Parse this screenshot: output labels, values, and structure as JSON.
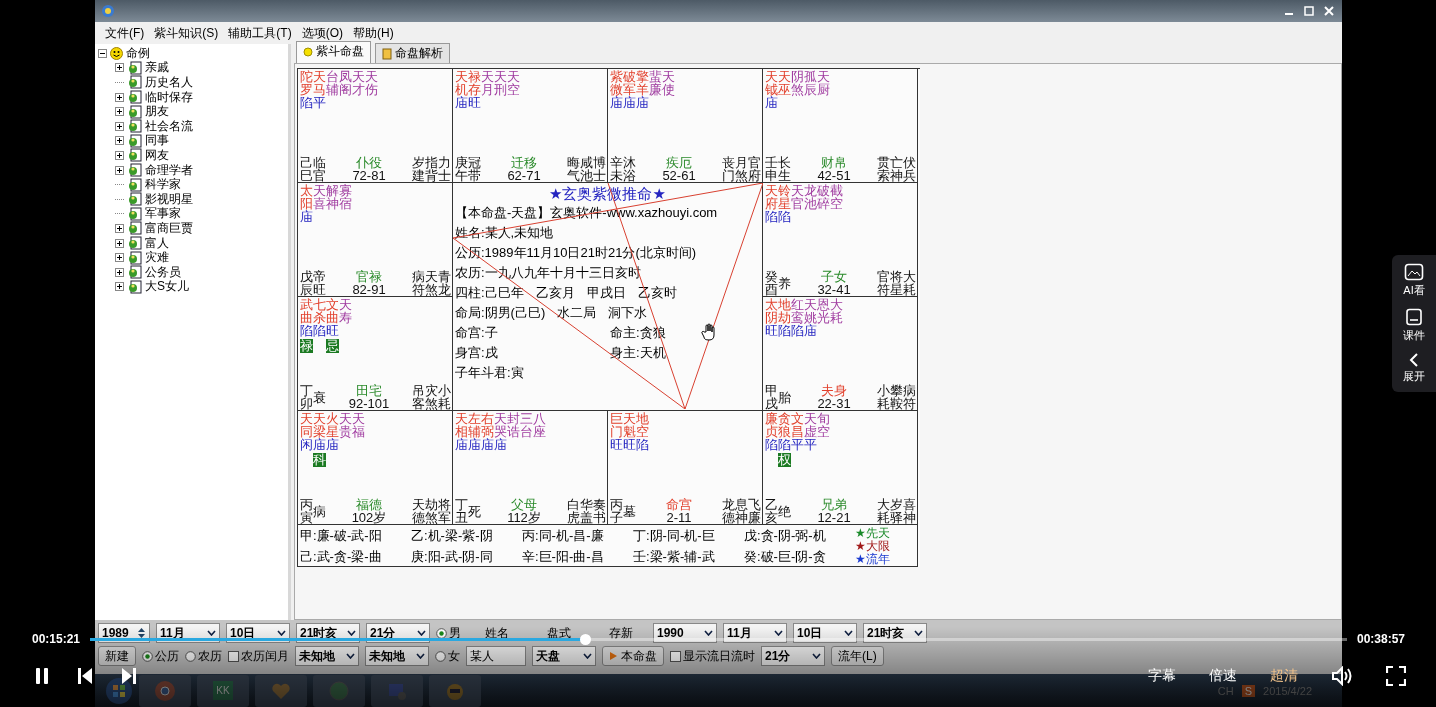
{
  "menu": [
    "文件(F)",
    "紫斗知识(S)",
    "辅助工具(T)",
    "选项(O)",
    "帮助(H)"
  ],
  "tree": {
    "root": {
      "label": "命例",
      "expanded": true,
      "children": [
        {
          "label": "亲戚",
          "has_children": true
        },
        {
          "label": "历史名人",
          "has_children": false
        },
        {
          "label": "临时保存",
          "has_children": true
        },
        {
          "label": "朋友",
          "has_children": true
        },
        {
          "label": "社会名流",
          "has_children": true
        },
        {
          "label": "同事",
          "has_children": true
        },
        {
          "label": "网友",
          "has_children": true
        },
        {
          "label": "命理学者",
          "has_children": true
        },
        {
          "label": "科学家",
          "has_children": false
        },
        {
          "label": "影视明星",
          "has_children": false
        },
        {
          "label": "军事家",
          "has_children": false
        },
        {
          "label": "富商巨贾",
          "has_children": true
        },
        {
          "label": "富人",
          "has_children": true
        },
        {
          "label": "灾难",
          "has_children": true
        },
        {
          "label": "公务员",
          "has_children": true
        },
        {
          "label": "大S女儿",
          "has_children": true
        }
      ]
    }
  },
  "tabs": [
    {
      "label": "紫斗命盘",
      "kind": "chart",
      "selected": true
    },
    {
      "label": "命盘解析",
      "kind": "book",
      "selected": false
    }
  ],
  "chart": {
    "palaces": [
      {
        "stars": [
          {
            "name": "陀罗",
            "kind": "major",
            "brightness": "陷"
          },
          {
            "name": "天马",
            "kind": "major",
            "brightness": "平"
          },
          {
            "name": "台辅",
            "kind": "minor"
          },
          {
            "name": "凤阁",
            "kind": "minor"
          },
          {
            "name": "天才",
            "kind": "minor"
          },
          {
            "name": "天伤",
            "kind": "minor"
          }
        ],
        "stem_branch": "己巳",
        "stage": "临官",
        "name": "仆役",
        "age": "72-81",
        "highlight": false,
        "gods": [
          "岁建",
          "指背",
          "力士"
        ]
      },
      {
        "stars": [
          {
            "name": "天机",
            "kind": "major",
            "brightness": "庙"
          },
          {
            "name": "禄存",
            "kind": "major",
            "brightness": "旺"
          },
          {
            "name": "天月",
            "kind": "minor"
          },
          {
            "name": "天刑",
            "kind": "minor"
          },
          {
            "name": "天空",
            "kind": "minor"
          }
        ],
        "stem_branch": "庚午",
        "stage": "冠带",
        "name": "迁移",
        "age": "62-71",
        "highlight": false,
        "gods": [
          "晦气",
          "咸池",
          "博士"
        ]
      },
      {
        "stars": [
          {
            "name": "紫微",
            "kind": "major",
            "brightness": "庙"
          },
          {
            "name": "破军",
            "kind": "major",
            "brightness": "庙"
          },
          {
            "name": "擎羊",
            "kind": "major",
            "brightness": "庙"
          },
          {
            "name": "蜚廉",
            "kind": "minor"
          },
          {
            "name": "天使",
            "kind": "minor"
          }
        ],
        "stem_branch": "辛未",
        "stage": "沐浴",
        "name": "疾厄",
        "age": "52-61",
        "highlight": false,
        "gods": [
          "丧门",
          "月煞",
          "官府"
        ]
      },
      {
        "stars": [
          {
            "name": "天钺",
            "kind": "major",
            "brightness": "庙"
          },
          {
            "name": "天巫",
            "kind": "major"
          },
          {
            "name": "阴煞",
            "kind": "minor"
          },
          {
            "name": "孤辰",
            "kind": "minor"
          },
          {
            "name": "天厨",
            "kind": "minor"
          }
        ],
        "stem_branch": "壬申",
        "stage": "长生",
        "name": "财帛",
        "age": "42-51",
        "highlight": false,
        "gods": [
          "贯索",
          "亡神",
          "伏兵"
        ]
      },
      {
        "stars": [
          {
            "name": "太阳",
            "kind": "major",
            "brightness": "庙"
          },
          {
            "name": "天喜",
            "kind": "minor"
          },
          {
            "name": "解神",
            "kind": "minor"
          },
          {
            "name": "寡宿",
            "kind": "minor"
          }
        ],
        "stem_branch": "戊辰",
        "stage": "帝旺",
        "name": "官禄",
        "age": "82-91",
        "highlight": false,
        "gods": [
          "病符",
          "天煞",
          "青龙"
        ]
      },
      {
        "stars": [
          {
            "name": "天府",
            "kind": "major",
            "brightness": "陷"
          },
          {
            "name": "铃星",
            "kind": "major",
            "brightness": "陷"
          },
          {
            "name": "天官",
            "kind": "minor"
          },
          {
            "name": "龙池",
            "kind": "minor"
          },
          {
            "name": "破碎",
            "kind": "minor"
          },
          {
            "name": "截空",
            "kind": "minor"
          }
        ],
        "stem_branch": "癸酉",
        "stage": "养",
        "name": "子女",
        "age": "32-41",
        "highlight": false,
        "gods": [
          "官符",
          "将星",
          "大耗"
        ]
      },
      {
        "stars": [
          {
            "name": "武曲",
            "kind": "major",
            "brightness": "陷",
            "hua": "禄"
          },
          {
            "name": "七杀",
            "kind": "major",
            "brightness": "陷"
          },
          {
            "name": "文曲",
            "kind": "major",
            "brightness": "旺",
            "hua": "忌"
          },
          {
            "name": "天寿",
            "kind": "minor"
          }
        ],
        "stem_branch": "丁卯",
        "stage": "衰",
        "name": "田宅",
        "age": "92-101",
        "highlight": false,
        "gods": [
          "吊客",
          "灾煞",
          "小耗"
        ]
      },
      {
        "stars": [
          {
            "name": "太阴",
            "kind": "major",
            "brightness": "旺"
          },
          {
            "name": "地劫",
            "kind": "major",
            "brightness": "陷"
          },
          {
            "name": "红鸾",
            "kind": "minor",
            "brightness": "陷"
          },
          {
            "name": "天姚",
            "kind": "minor",
            "brightness": "庙"
          },
          {
            "name": "恩光",
            "kind": "minor"
          },
          {
            "name": "大耗",
            "kind": "minor"
          }
        ],
        "stem_branch": "甲戌",
        "stage": "胎",
        "name": "夫身",
        "age": "22-31",
        "highlight": true,
        "gods": [
          "小耗",
          "攀鞍",
          "病符"
        ]
      },
      {
        "stars": [
          {
            "name": "天同",
            "kind": "major",
            "brightness": "闲"
          },
          {
            "name": "天梁",
            "kind": "major",
            "brightness": "庙",
            "hua": "科"
          },
          {
            "name": "火星",
            "kind": "major",
            "brightness": "庙"
          },
          {
            "name": "天贵",
            "kind": "minor"
          },
          {
            "name": "天福",
            "kind": "minor"
          }
        ],
        "stem_branch": "丙寅",
        "stage": "病",
        "name": "福德",
        "age": "102岁",
        "highlight": false,
        "gods": [
          "天德",
          "劫煞",
          "将军"
        ]
      },
      {
        "stars": [
          {
            "name": "天相",
            "kind": "major",
            "brightness": "庙"
          },
          {
            "name": "左辅",
            "kind": "major",
            "brightness": "庙"
          },
          {
            "name": "右弼",
            "kind": "major",
            "brightness": "庙"
          },
          {
            "name": "天哭",
            "kind": "minor",
            "brightness": "庙"
          },
          {
            "name": "封诰",
            "kind": "minor"
          },
          {
            "name": "三台",
            "kind": "minor"
          },
          {
            "name": "八座",
            "kind": "minor"
          }
        ],
        "stem_branch": "丁丑",
        "stage": "死",
        "name": "父母",
        "age": "112岁",
        "highlight": false,
        "gods": [
          "白虎",
          "华盖",
          "奏书"
        ]
      },
      {
        "stars": [
          {
            "name": "巨门",
            "kind": "major",
            "brightness": "旺"
          },
          {
            "name": "天魁",
            "kind": "major",
            "brightness": "旺"
          },
          {
            "name": "地空",
            "kind": "major",
            "brightness": "陷"
          }
        ],
        "stem_branch": "丙子",
        "stage": "墓",
        "name": "命宫",
        "age": "2-11",
        "highlight": true,
        "gods": [
          "龙德",
          "息神",
          "飞廉"
        ]
      },
      {
        "stars": [
          {
            "name": "廉贞",
            "kind": "major",
            "brightness": "陷"
          },
          {
            "name": "贪狼",
            "kind": "major",
            "brightness": "陷",
            "hua": "权"
          },
          {
            "name": "文昌",
            "kind": "major",
            "brightness": "平"
          },
          {
            "name": "天虚",
            "kind": "minor",
            "brightness": "平"
          },
          {
            "name": "旬空",
            "kind": "minor"
          }
        ],
        "stem_branch": "乙亥",
        "stage": "绝",
        "name": "兄弟",
        "age": "12-21",
        "highlight": false,
        "gods": [
          "大耗",
          "岁驿",
          "喜神"
        ]
      }
    ],
    "center": {
      "title": "★玄奥紫微推命★",
      "info": [
        [
          "【本命盘-天盘】玄奥软件-www.xazhouyi.com"
        ],
        [
          "姓名:某人,未知地"
        ],
        [
          "公历:1989年11月10日21时21分(北京时间)"
        ],
        [
          "农历:一九八九年十月十三日亥时"
        ],
        [
          "四柱:己巳年",
          "乙亥月",
          "甲戌日",
          "乙亥时"
        ],
        [
          "命局:阴男(己巳)",
          "水二局",
          "洞下水"
        ],
        [
          "命宫:子",
          "命主:贪狼"
        ],
        [
          "身宫:戌",
          "身主:天机"
        ],
        [
          "子年斗君:寅"
        ]
      ]
    },
    "transforms": [
      "甲:廉-破-武-阳",
      "乙:机-梁-紫-阴",
      "丙:同-机-昌-廉",
      "丁:阴-同-机-巨",
      "戊:贪-阴-弼-机",
      "己:武-贪-梁-曲",
      "庚:阳-武-阴-同",
      "辛:巨-阳-曲-昌",
      "壬:梁-紫-辅-武",
      "癸:破-巨-阴-贪"
    ],
    "legend_stars": [
      {
        "star": "★",
        "label": "先天",
        "color": "#1a8a2a"
      },
      {
        "star": "★",
        "label": "大限",
        "color": "#a01818"
      },
      {
        "star": "★",
        "label": "流年",
        "color": "#1a3ad0"
      }
    ]
  },
  "form": {
    "row1": [
      {
        "kind": "spinner",
        "value": "1989"
      },
      {
        "kind": "select",
        "value": "11月"
      },
      {
        "kind": "select",
        "value": "10日"
      },
      {
        "kind": "select",
        "value": "21时亥"
      },
      {
        "kind": "select",
        "value": "21分"
      },
      {
        "kind": "radio",
        "label": "男",
        "selected": true
      },
      {
        "kind": "label",
        "text": "姓名"
      },
      {
        "kind": "label",
        "text": "盘式"
      },
      {
        "kind": "label",
        "text": "存新"
      },
      {
        "kind": "select",
        "value": "1990"
      },
      {
        "kind": "select",
        "value": "11月"
      },
      {
        "kind": "select",
        "value": "10日"
      },
      {
        "kind": "select",
        "value": "21时亥"
      }
    ],
    "row2": [
      {
        "kind": "button",
        "label": "新建"
      },
      {
        "kind": "radio",
        "label": "公历",
        "selected": true
      },
      {
        "kind": "radio",
        "label": "农历",
        "selected": false
      },
      {
        "kind": "checkbox",
        "label": "农历闰月",
        "checked": false
      },
      {
        "kind": "select",
        "value": "未知地"
      },
      {
        "kind": "select",
        "value": "未知地"
      },
      {
        "kind": "radio",
        "label": "女",
        "selected": false
      },
      {
        "kind": "input",
        "value": "某人"
      },
      {
        "kind": "select",
        "value": "天盘"
      },
      {
        "kind": "run_button",
        "label": "本命盘"
      },
      {
        "kind": "checkbox",
        "label": "显示流日流时",
        "checked": false
      },
      {
        "kind": "select",
        "value": "21分"
      },
      {
        "kind": "button",
        "label": "流年(L)"
      }
    ]
  },
  "taskbar": {
    "apps": [
      {
        "kind": "start"
      },
      {
        "kind": "browser"
      },
      {
        "kind": "tile",
        "label": "KK"
      },
      {
        "kind": "heart"
      },
      {
        "kind": "globe"
      },
      {
        "kind": "window"
      },
      {
        "kind": "mascot"
      }
    ],
    "ime": "CH",
    "ime_badge": "S",
    "date": "2015/4/22"
  },
  "player": {
    "current_time": "00:15:21",
    "total_time": "00:38:57",
    "level": 0.394,
    "playing": true,
    "options": [
      {
        "label": "字幕",
        "selected": false
      },
      {
        "label": "倍速",
        "selected": false
      },
      {
        "label": "超清",
        "selected": true
      }
    ]
  },
  "side_panel": [
    {
      "label": "AI看",
      "kind": "ai"
    },
    {
      "label": "课件",
      "kind": "doc"
    },
    {
      "label": "展开",
      "kind": "expand"
    }
  ]
}
